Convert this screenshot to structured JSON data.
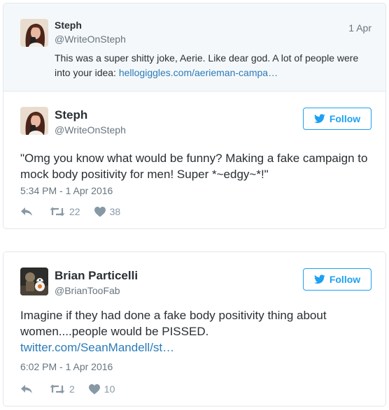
{
  "colors": {
    "twitter_blue": "#1da1f2",
    "link_blue": "#2b7bb9",
    "text_dark": "#292f33",
    "text_gray": "#66757f",
    "icon_gray": "#8899a6",
    "quote_bg": "#f5f8fa",
    "border": "#e1e8ed"
  },
  "tweet1": {
    "quoted": {
      "name": "Steph",
      "handle": "@WriteOnSteph",
      "date": "1 Apr",
      "text": "This was a super shitty joke, Aerie. Like dear god. A lot of people were into your idea: ",
      "link": "hellogiggles.com/aerieman-campa…"
    },
    "name": "Steph",
    "handle": "@WriteOnSteph",
    "follow_label": "Follow",
    "text": "\"Omg you know what would be funny? Making a fake campaign to mock body positivity for men! Super *~edgy~*!\"",
    "timestamp": "5:34 PM - 1 Apr 2016",
    "retweets": "22",
    "likes": "38",
    "icons": [
      "reply-icon",
      "retweet-icon",
      "heart-icon",
      "twitter-bird-icon"
    ]
  },
  "tweet2": {
    "name": "Brian Particelli",
    "handle": "@BrianTooFab",
    "follow_label": "Follow",
    "text": "Imagine if they had done a fake body positivity thing about women....people would be PISSED.",
    "link": "twitter.com/SeanMandell/st…",
    "timestamp": "6:02 PM - 1 Apr 2016",
    "retweets": "2",
    "likes": "10",
    "icons": [
      "reply-icon",
      "retweet-icon",
      "heart-icon",
      "twitter-bird-icon"
    ]
  }
}
